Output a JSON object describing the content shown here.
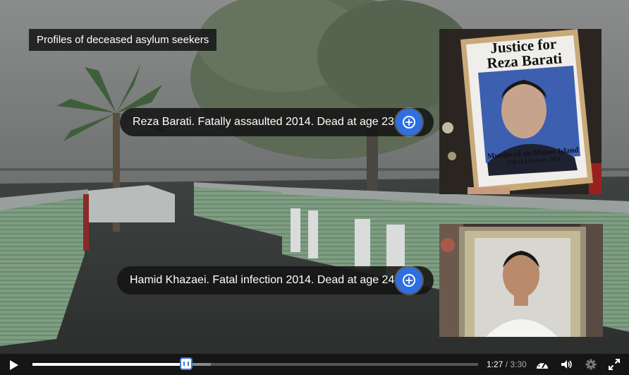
{
  "overlay": {
    "title": "Profiles of deceased asylum seekers"
  },
  "hotspots": [
    {
      "label": "Reza Barati. Fatally assaulted 2014. Dead at age 23"
    },
    {
      "label": "Hamid Khazaei. Fatal infection 2014. Dead at age 24"
    }
  ],
  "photos": {
    "reza": {
      "sign_line1": "Justice for",
      "sign_line2": "Reza Barati",
      "caption": "Murdered on Manus Island",
      "date": "17th of February 2014"
    }
  },
  "player": {
    "current_time": "1:27",
    "separator": " / ",
    "duration": "3:30",
    "progress": 0.345,
    "buffered": 0.4
  }
}
